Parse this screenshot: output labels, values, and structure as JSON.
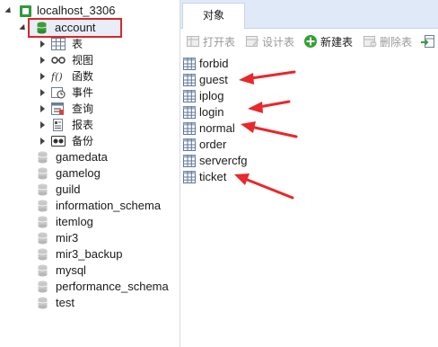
{
  "tree": {
    "connection": "localhost_3306",
    "selected_db": "account",
    "children": [
      {
        "label": "表",
        "icon": "table-icon"
      },
      {
        "label": "视图",
        "icon": "view-icon"
      },
      {
        "label": "函数",
        "icon": "function-icon"
      },
      {
        "label": "事件",
        "icon": "event-icon"
      },
      {
        "label": "查询",
        "icon": "query-icon"
      },
      {
        "label": "报表",
        "icon": "report-icon"
      },
      {
        "label": "备份",
        "icon": "backup-icon"
      }
    ],
    "databases": [
      "gamedata",
      "gamelog",
      "guild",
      "information_schema",
      "itemlog",
      "mir3",
      "mir3_backup",
      "mysql",
      "performance_schema",
      "test"
    ]
  },
  "tab": {
    "label": "对象"
  },
  "toolbar": {
    "open_table": "打开表",
    "design_table": "设计表",
    "new_table": "新建表",
    "delete_table": "删除表"
  },
  "tables": [
    "forbid",
    "guest",
    "iplog",
    "login",
    "normal",
    "order",
    "servercfg",
    "ticket"
  ],
  "colors": {
    "highlight_box": "#d8262a",
    "annotation_arrow": "#e8282b",
    "tab_strip": "#dfe9f7",
    "db_icon_selected": "#3a9d3a",
    "db_icon": "#c8c8c8"
  }
}
